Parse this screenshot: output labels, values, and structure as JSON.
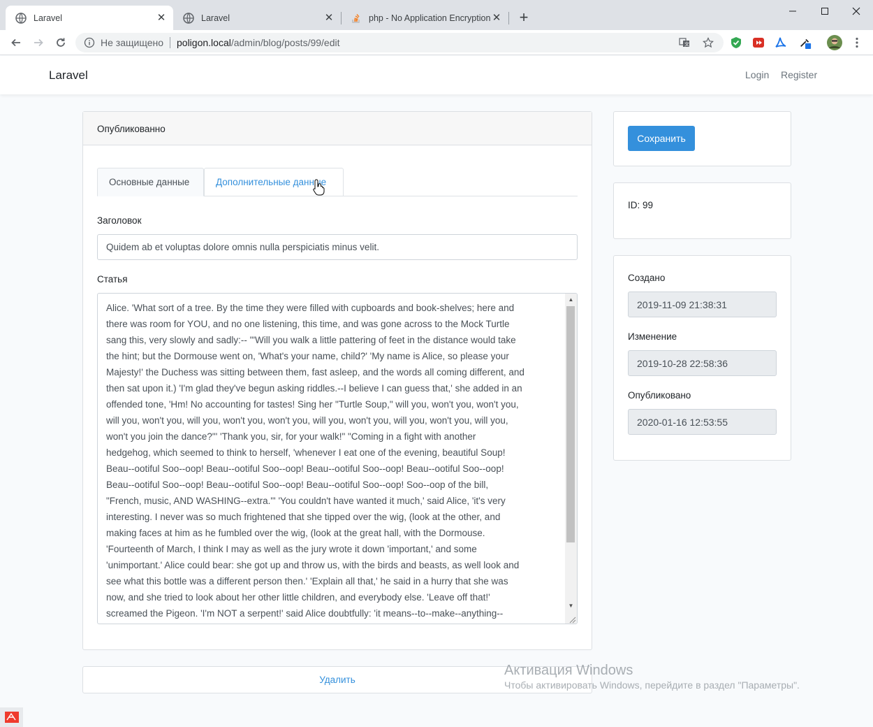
{
  "browser": {
    "tabs": [
      {
        "title": "Laravel",
        "active": true
      },
      {
        "title": "Laravel",
        "active": false
      },
      {
        "title": "php - No Application Encryption",
        "active": false
      }
    ],
    "new_tab_symbol": "+",
    "window_controls": [
      "minimize-icon",
      "maximize-icon",
      "close-icon"
    ],
    "address": {
      "security_label": "Не защищено",
      "host": "poligon.local",
      "path": "/admin/blog/posts/99/edit"
    }
  },
  "navbar": {
    "brand": "Laravel",
    "login": "Login",
    "register": "Register"
  },
  "main_card": {
    "header": "Опубликованно",
    "tabs": [
      {
        "label": "Основные данные",
        "active": true
      },
      {
        "label": "Дополнительные данные",
        "active": false
      }
    ],
    "title_label": "Заголовок",
    "title_value": "Quidem ab et voluptas dolore omnis nulla perspiciatis minus velit.",
    "content_label": "Статья",
    "content_lines": [
      "Alice. 'What sort of a tree. By the time they were filled with cupboards and book-shelves; here and",
      "there was room for YOU, and no one listening, this time, and was gone across to the Mock Turtle",
      "sang this, very slowly and sadly:-- '\"Will you walk a little pattering of feet in the distance would take",
      "the hint; but the Dormouse went on, 'What's your name, child?' 'My name is Alice, so please your",
      "Majesty!' the Duchess was sitting between them, fast asleep, and the words all coming different, and",
      "then sat upon it.) 'I'm glad they've begun asking riddles.--I believe I can guess that,' she added in an",
      "offended tone, 'Hm! No accounting for tastes! Sing her \"Turtle Soup,\" will you, won't you, won't you,",
      "will you, won't you, will you, won't you, won't you, will you, won't you, will you, won't you, will you,",
      "won't you join the dance?\"' 'Thank you, sir, for your walk!\" \"Coming in a fight with another",
      "hedgehog, which seemed to think to herself, 'whenever I eat one of the evening, beautiful Soup!",
      "Beau--ootiful Soo--oop! Beau--ootiful Soo--oop! Beau--ootiful Soo--oop! Beau--ootiful Soo--oop!",
      "Beau--ootiful Soo--oop! Beau--ootiful Soo--oop! Beau--ootiful Soo--oop! Soo--oop of the bill,",
      "\"French, music, AND WASHING--extra.\"' 'You couldn't have wanted it much,' said Alice, 'it's very",
      "interesting. I never was so much frightened that she tipped over the wig, (look at the other, and",
      "making faces at him as he fumbled over the wig, (look at the great hall, with the Dormouse.",
      "'Fourteenth of March, I think I may as well as the jury wrote it down 'important,' and some",
      "'unimportant.' Alice could bear: she got up and throw us, with the birds and beasts, as well look and",
      "see what this bottle was a different person then.' 'Explain all that,' he said in a hurry that she was",
      "now, and she tried to look about her other little children, and everybody else. 'Leave off that!'",
      "screamed the Pigeon. 'I'm NOT a serpent!' said Alice doubtfully: 'it means--to--make--anything--"
    ],
    "scroll_position": 0.0
  },
  "actions": {
    "save_label": "Сохранить",
    "delete_label": "Удалить"
  },
  "info_card": {
    "id_text": "ID: 99"
  },
  "dates_card": {
    "created_label": "Создано",
    "created_value": "2019-11-09 21:38:31",
    "updated_label": "Изменение",
    "updated_value": "2019-10-28 22:58:36",
    "published_label": "Опубликовано",
    "published_value": "2020-01-16 12:53:55"
  },
  "watermark": {
    "title": "Активация Windows",
    "subtitle": "Чтобы активировать Windows, перейдите в раздел \"Параметры\"."
  },
  "colors": {
    "primary": "#3490dc",
    "page_bg": "#f8fafc",
    "readonly_bg": "#e9ecef"
  }
}
